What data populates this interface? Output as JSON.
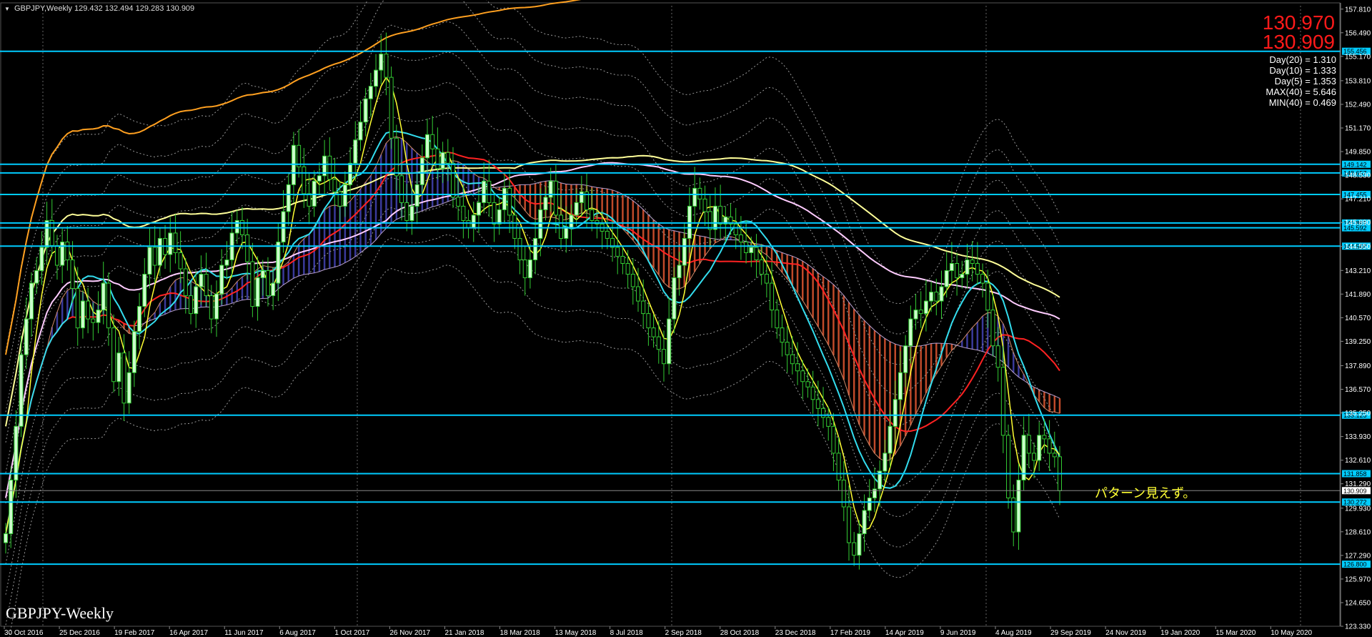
{
  "header": {
    "symbol": "GBPJPY,Weekly",
    "ohlc": "129.432 132.494 129.283 130.909"
  },
  "prices": {
    "bid": "130.970",
    "ask": "130.909"
  },
  "stats": [
    "Day(20) = 1.310",
    "Day(10) = 1.333",
    "Day(5) = 1.353",
    "MAX(40) = 5.646",
    "MIN(40) = 0.469"
  ],
  "watermark": "GBPJPY-Weekly",
  "annotation": "パターン見えず。",
  "colors": {
    "background": "#000000",
    "bull_candle": "#ccffcc",
    "bear_candle": "#000000",
    "candle_outline": "#33cc33",
    "level_line": "#00ccff",
    "ma_fast": "#ffff33",
    "ma_mid": "#33ddee",
    "ma_slow": "#ff2222",
    "ma_long": "#ffa020",
    "kumo_bull": "#3a3a9a",
    "kumo_bear": "#c04a2a",
    "bid": "#ff1a1a"
  },
  "chart_data": {
    "type": "candlestick",
    "title": "GBPJPY,Weekly",
    "ylim": [
      123.33,
      158.0
    ],
    "y_ticks": [
      "157.810",
      "156.490",
      "155.170",
      "153.810",
      "152.490",
      "151.170",
      "149.850",
      "148.530",
      "147.210",
      "145.890",
      "144.550",
      "143.210",
      "141.890",
      "140.570",
      "139.250",
      "137.890",
      "136.570",
      "135.250",
      "133.930",
      "132.610",
      "131.290",
      "129.930",
      "128.610",
      "127.290",
      "125.970",
      "124.650",
      "123.330"
    ],
    "x_labels": [
      "30 Oct 2016",
      "25 Dec 2016",
      "19 Feb 2017",
      "16 Apr 2017",
      "11 Jun 2017",
      "6 Aug 2017",
      "1 Oct 2017",
      "26 Nov 2017",
      "21 Jan 2018",
      "18 Mar 2018",
      "13 May 2018",
      "8 Jul 2018",
      "2 Sep 2018",
      "28 Oct 2018",
      "23 Dec 2018",
      "17 Feb 2019",
      "14 Apr 2019",
      "9 Jun 2019",
      "4 Aug 2019",
      "29 Sep 2019",
      "24 Nov 2019",
      "19 Jan 2020",
      "15 Mar 2020",
      "10 May 2020"
    ],
    "price_levels": [
      {
        "label": "155.456",
        "value": 155.456
      },
      {
        "label": "149.142",
        "value": 149.142
      },
      {
        "label": "148.657",
        "value": 148.657
      },
      {
        "label": "147.455",
        "value": 147.455
      },
      {
        "label": "145.862",
        "value": 145.862
      },
      {
        "label": "145.592",
        "value": 145.592
      },
      {
        "label": "144.568",
        "value": 144.568
      },
      {
        "label": "135.123",
        "value": 135.123
      },
      {
        "label": "131.858",
        "value": 131.858
      },
      {
        "label": "130.272",
        "value": 130.272
      },
      {
        "label": "126.800",
        "value": 126.8
      }
    ],
    "current_price": {
      "label": "130.909",
      "value": 130.909
    },
    "closes": [
      128.5,
      131.5,
      134.5,
      138.5,
      140.5,
      142.5,
      143.2,
      144.5,
      146.0,
      144.6,
      143.5,
      144.8,
      143.8,
      142.2,
      140.0,
      141.5,
      140.5,
      140.3,
      141.0,
      142.5,
      140.0,
      137.0,
      138.6,
      135.8,
      137.5,
      139.8,
      141.2,
      143.0,
      144.5,
      143.5,
      145.0,
      144.1,
      145.3,
      144.2,
      143.3,
      141.8,
      140.8,
      142.3,
      143.0,
      141.8,
      140.5,
      141.9,
      143.5,
      143.8,
      145.3,
      146.0,
      145.2,
      143.7,
      141.2,
      142.8,
      143.2,
      141.8,
      142.5,
      144.8,
      146.5,
      148.0,
      150.2,
      149.0,
      147.5,
      146.8,
      148.2,
      148.5,
      149.6,
      148.3,
      147.6,
      146.8,
      148.0,
      149.2,
      150.5,
      151.5,
      152.8,
      153.5,
      154.4,
      155.3,
      154.0,
      150.6,
      148.5,
      147.0,
      146.0,
      146.8,
      148.0,
      149.5,
      150.8,
      150.0,
      148.9,
      149.8,
      149.2,
      147.3,
      146.8,
      146.0,
      145.6,
      146.3,
      147.0,
      148.2,
      147.0,
      145.8,
      146.6,
      147.8,
      146.3,
      145.0,
      143.8,
      142.8,
      143.8,
      145.0,
      146.6,
      147.3,
      148.2,
      146.3,
      145.0,
      145.6,
      146.3,
      147.0,
      147.6,
      146.6,
      146.0,
      145.8,
      145.4,
      145.0,
      144.5,
      144.0,
      143.6,
      143.0,
      142.3,
      141.5,
      140.8,
      140.0,
      139.5,
      138.8,
      138.0,
      140.5,
      142.8,
      143.5,
      145.0,
      146.8,
      147.8,
      147.2,
      146.5,
      145.5,
      146.8,
      145.8,
      146.2,
      145.8,
      145.2,
      144.8,
      144.2,
      144.5,
      143.8,
      143.0,
      142.5,
      141.0,
      140.0,
      139.2,
      138.5,
      138.0,
      137.6,
      137.0,
      136.7,
      136.0,
      135.5,
      135.0,
      134.5,
      133.0,
      131.5,
      130.0,
      128.0,
      127.3,
      128.5,
      129.8,
      130.5,
      131.0,
      132.0,
      133.0,
      134.5,
      136.0,
      137.5,
      139.0,
      140.5,
      141.0,
      140.8,
      141.5,
      142.0,
      141.5,
      142.3,
      143.2,
      143.6,
      142.8,
      143.0,
      143.8,
      143.6,
      143.0,
      142.5,
      141.0,
      139.0,
      137.8,
      134.0,
      130.5,
      128.6,
      131.5,
      134.0,
      133.0,
      132.6,
      134.0,
      133.8,
      133.0,
      132.8,
      130.9
    ],
    "yellow_ma": "fast",
    "cyan_ma": "mid",
    "red_ma": "slow",
    "orange_ma": "long",
    "extra_ma_colors": [
      "#ffff99",
      "#ffccff"
    ],
    "x_start": 8,
    "x_end": 1483
  }
}
